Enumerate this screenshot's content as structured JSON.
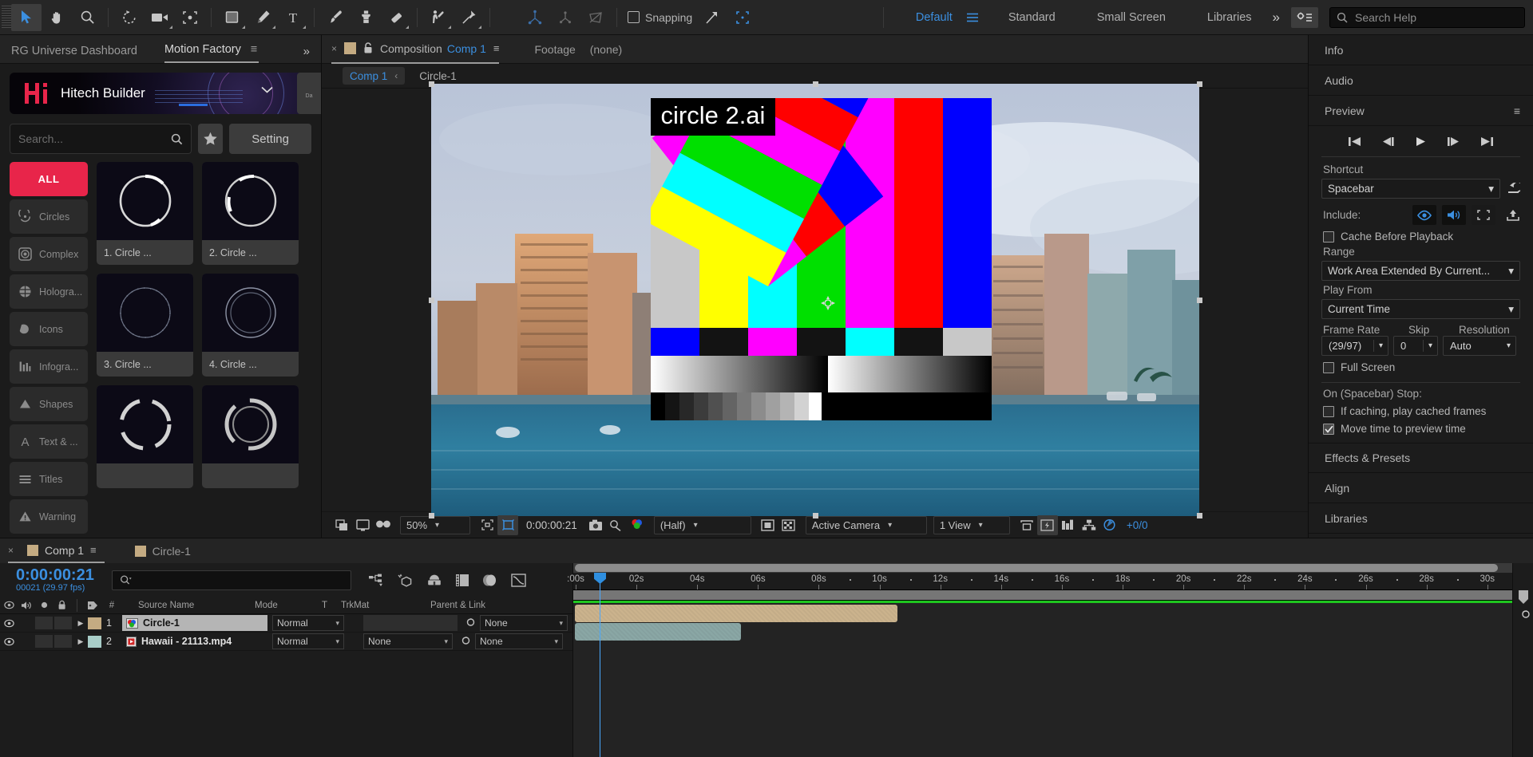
{
  "toolbar": {
    "tools": [
      "selection-tool",
      "hand-tool",
      "zoom-tool",
      "rotation-tool",
      "camera-tool",
      "pan-behind-tool",
      "shape-tool",
      "pen-tool",
      "type-tool",
      "brush-tool",
      "clone-stamp-tool",
      "eraser-tool",
      "roto-brush-tool",
      "puppet-pin-tool"
    ],
    "axis_tools": [
      "local-axis-mode",
      "world-axis-mode",
      "view-axis-mode"
    ],
    "snapping_label": "Snapping",
    "workspaces": [
      {
        "label": "Default",
        "active": true
      },
      {
        "label": "Standard",
        "active": false
      },
      {
        "label": "Small Screen",
        "active": false
      },
      {
        "label": "Libraries",
        "active": false
      }
    ],
    "overflow_label": "»",
    "search_help_placeholder": "Search Help"
  },
  "extension": {
    "tabs": [
      {
        "label": "RG Universe Dashboard",
        "active": false
      },
      {
        "label": "Motion Factory",
        "active": true
      }
    ],
    "overflow_label": "»",
    "brand": {
      "name": "Hitech Builder",
      "logo": "Hi"
    },
    "dock_label": "Da",
    "search": {
      "placeholder": "Search...",
      "value": ""
    },
    "favorite_label": "★",
    "setting_label": "Setting",
    "categories": [
      {
        "label": "ALL",
        "icon": "all-icon",
        "active": true
      },
      {
        "label": "Circles",
        "icon": "circles-icon",
        "active": false
      },
      {
        "label": "Complex",
        "icon": "complex-icon",
        "active": false
      },
      {
        "label": "Hologra...",
        "icon": "hologram-icon",
        "active": false
      },
      {
        "label": "Icons",
        "icon": "icons-icon",
        "active": false
      },
      {
        "label": "Infogra...",
        "icon": "infographic-icon",
        "active": false
      },
      {
        "label": "Shapes",
        "icon": "shapes-icon",
        "active": false
      },
      {
        "label": "Text & ...",
        "icon": "text-icon",
        "active": false
      },
      {
        "label": "Titles",
        "icon": "titles-icon",
        "active": false
      },
      {
        "label": "Warning",
        "icon": "warning-icon",
        "active": false
      }
    ],
    "thumbnails": [
      {
        "label": "1. Circle ..."
      },
      {
        "label": "2. Circle ..."
      },
      {
        "label": "3. Circle ..."
      },
      {
        "label": "4. Circle ..."
      },
      {
        "label": ""
      },
      {
        "label": ""
      }
    ]
  },
  "comp_panel": {
    "close_label": "×",
    "type_label": "Composition",
    "comp_name": "Comp 1",
    "footage_label": "Footage",
    "footage_value": "(none)",
    "breadcrumb_pill": "Comp 1",
    "breadcrumb_child": "Circle-1",
    "layer_name_overlay": "circle 2.ai",
    "toolbar": {
      "magnification": "50%",
      "current_time": "0:00:00:21",
      "resolution": "(Half)",
      "camera": "Active Camera",
      "views": "1 View",
      "render_counter": "+0/0"
    }
  },
  "right_panel": {
    "sections": [
      {
        "title": "Info"
      },
      {
        "title": "Audio"
      },
      {
        "title": "Preview"
      }
    ],
    "preview": {
      "title": "Preview",
      "transport": [
        "first-frame-button",
        "previous-frame-button",
        "play-button",
        "next-frame-button",
        "last-frame-button"
      ],
      "shortcut_label": "Shortcut",
      "shortcut_value": "Spacebar",
      "reset_icon": "reset-icon",
      "include_label": "Include:",
      "include_toggles": [
        "video-icon",
        "audio-icon",
        "overlays-icon"
      ],
      "export_icon": "export-icon",
      "cache_before_playback_label": "Cache Before Playback",
      "cache_before_playback_checked": false,
      "range_label": "Range",
      "range_value": "Work Area Extended By Current...",
      "play_from_label": "Play From",
      "play_from_value": "Current Time",
      "frame_rate_label": "Frame Rate",
      "frame_rate_value": "(29/97)",
      "skip_label": "Skip",
      "skip_value": "0",
      "resolution_label": "Resolution",
      "resolution_value": "Auto",
      "full_screen_label": "Full Screen",
      "full_screen_checked": false,
      "on_stop_label": "On (Spacebar) Stop:",
      "if_caching_label": "If caching, play cached frames",
      "if_caching_checked": false,
      "move_time_label": "Move time to preview time",
      "move_time_checked": true
    },
    "bottom_sections": [
      {
        "title": "Effects & Presets"
      },
      {
        "title": "Align"
      },
      {
        "title": "Libraries"
      }
    ]
  },
  "timeline": {
    "tabs": [
      {
        "label": "Comp 1",
        "active": true
      },
      {
        "label": "Circle-1",
        "active": false
      }
    ],
    "close_label": "×",
    "current_time": "0:00:00:21",
    "frame_info": "00021 (29.97 fps)",
    "search_placeholder": "",
    "icons": [
      "composition-mini-flowchart-icon",
      "draft-3d-icon",
      "hide-shy-layers-icon",
      "frame-blending-icon",
      "motion-blur-icon",
      "graph-editor-icon"
    ],
    "columns": [
      "#",
      "Source Name",
      "Mode",
      "T",
      "TrkMat",
      "Parent & Link"
    ],
    "layers": [
      {
        "index": "1",
        "name": "Circle-1",
        "mode": "Normal",
        "trkmat": "",
        "parent": "None",
        "color": "#c4ab82",
        "selected": true,
        "icon": "comp-icon"
      },
      {
        "index": "2",
        "name": "Hawaii - 21113.mp4",
        "mode": "Normal",
        "trkmat": "None",
        "parent": "None",
        "color": "#a8cdc8",
        "selected": false,
        "icon": "video-icon"
      }
    ],
    "ruler_ticks": [
      ":00s",
      "02s",
      "04s",
      "06s",
      "08s",
      "10s",
      "12s",
      "14s",
      "16s",
      "18s",
      "20s",
      "22s",
      "24s",
      "26s",
      "28s",
      "30s"
    ]
  },
  "colors": {
    "accent_blue": "#3b8fe0",
    "accent_red": "#e8254a",
    "panel_bg": "#1c1c1c",
    "toolbar_bg": "#262626",
    "layer_tan": "#c4ab82",
    "layer_teal": "#a8cdc8",
    "work_green": "#1fc61f"
  }
}
